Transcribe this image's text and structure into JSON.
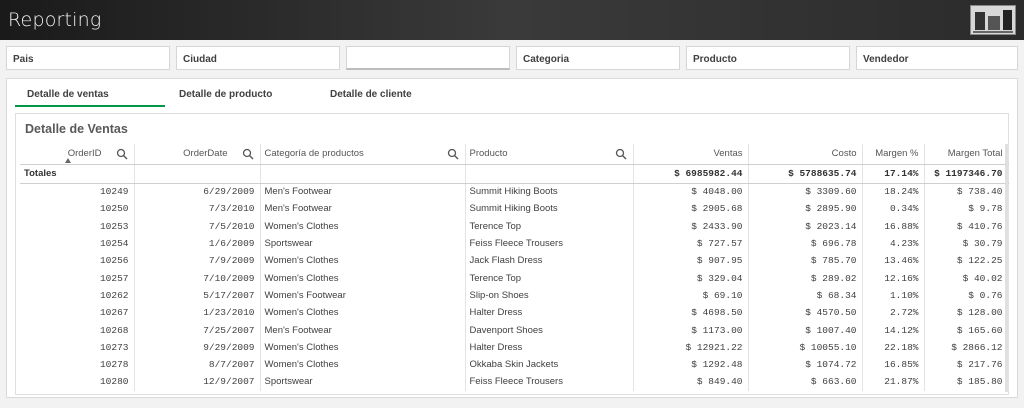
{
  "header": {
    "title": "Reporting",
    "logo_icon": "building-logo-icon"
  },
  "filters": [
    "Pais",
    "Ciudad",
    "",
    "Categoria",
    "Producto",
    "Vendedor"
  ],
  "tabs": [
    {
      "label": "Detalle de ventas",
      "active": true
    },
    {
      "label": "Detalle de producto",
      "active": false
    },
    {
      "label": "Detalle de cliente",
      "active": false
    }
  ],
  "table": {
    "title": "Detalle de Ventas",
    "columns": [
      "OrderID",
      "OrderDate",
      "Categoría de productos",
      "Producto",
      "Ventas",
      "Costo",
      "Margen %",
      "Margen Total"
    ],
    "totals": [
      "Totales",
      "",
      "",
      "",
      "$ 6985982.44",
      "$ 5788635.74",
      "17.14%",
      "$ 1197346.70"
    ],
    "rows": [
      [
        "10249",
        "6/29/2009",
        "Men's Footwear",
        "Summit Hiking Boots",
        "$ 4048.00",
        "$ 3309.60",
        "18.24%",
        "$ 738.40"
      ],
      [
        "10250",
        "7/3/2010",
        "Men's Footwear",
        "Summit Hiking Boots",
        "$ 2905.68",
        "$ 2895.90",
        "0.34%",
        "$ 9.78"
      ],
      [
        "10253",
        "7/5/2010",
        "Women's Clothes",
        "Terence Top",
        "$ 2433.90",
        "$ 2023.14",
        "16.88%",
        "$ 410.76"
      ],
      [
        "10254",
        "1/6/2009",
        "Sportswear",
        "Feiss Fleece Trousers",
        "$ 727.57",
        "$ 696.78",
        "4.23%",
        "$ 30.79"
      ],
      [
        "10256",
        "7/9/2009",
        "Women's Clothes",
        "Jack Flash Dress",
        "$ 907.95",
        "$ 785.70",
        "13.46%",
        "$ 122.25"
      ],
      [
        "10257",
        "7/10/2009",
        "Women's Clothes",
        "Terence Top",
        "$ 329.04",
        "$ 289.02",
        "12.16%",
        "$ 40.02"
      ],
      [
        "10262",
        "5/17/2007",
        "Women's Footwear",
        "Slip-on Shoes",
        "$ 69.10",
        "$ 68.34",
        "1.10%",
        "$ 0.76"
      ],
      [
        "10267",
        "1/23/2010",
        "Women's Clothes",
        "Halter Dress",
        "$ 4698.50",
        "$ 4570.50",
        "2.72%",
        "$ 128.00"
      ],
      [
        "10268",
        "7/25/2007",
        "Men's Footwear",
        "Davenport Shoes",
        "$ 1173.00",
        "$ 1007.40",
        "14.12%",
        "$ 165.60"
      ],
      [
        "10273",
        "9/29/2009",
        "Women's Clothes",
        "Halter Dress",
        "$ 12921.22",
        "$ 10055.10",
        "22.18%",
        "$ 2866.12"
      ],
      [
        "10278",
        "8/7/2007",
        "Women's Clothes",
        "Okkaba Skin Jackets",
        "$ 1292.48",
        "$ 1074.72",
        "16.85%",
        "$ 217.76"
      ],
      [
        "10280",
        "12/9/2007",
        "Sportswear",
        "Feiss Fleece Trousers",
        "$ 849.40",
        "$ 663.60",
        "21.87%",
        "$ 185.80"
      ]
    ]
  }
}
